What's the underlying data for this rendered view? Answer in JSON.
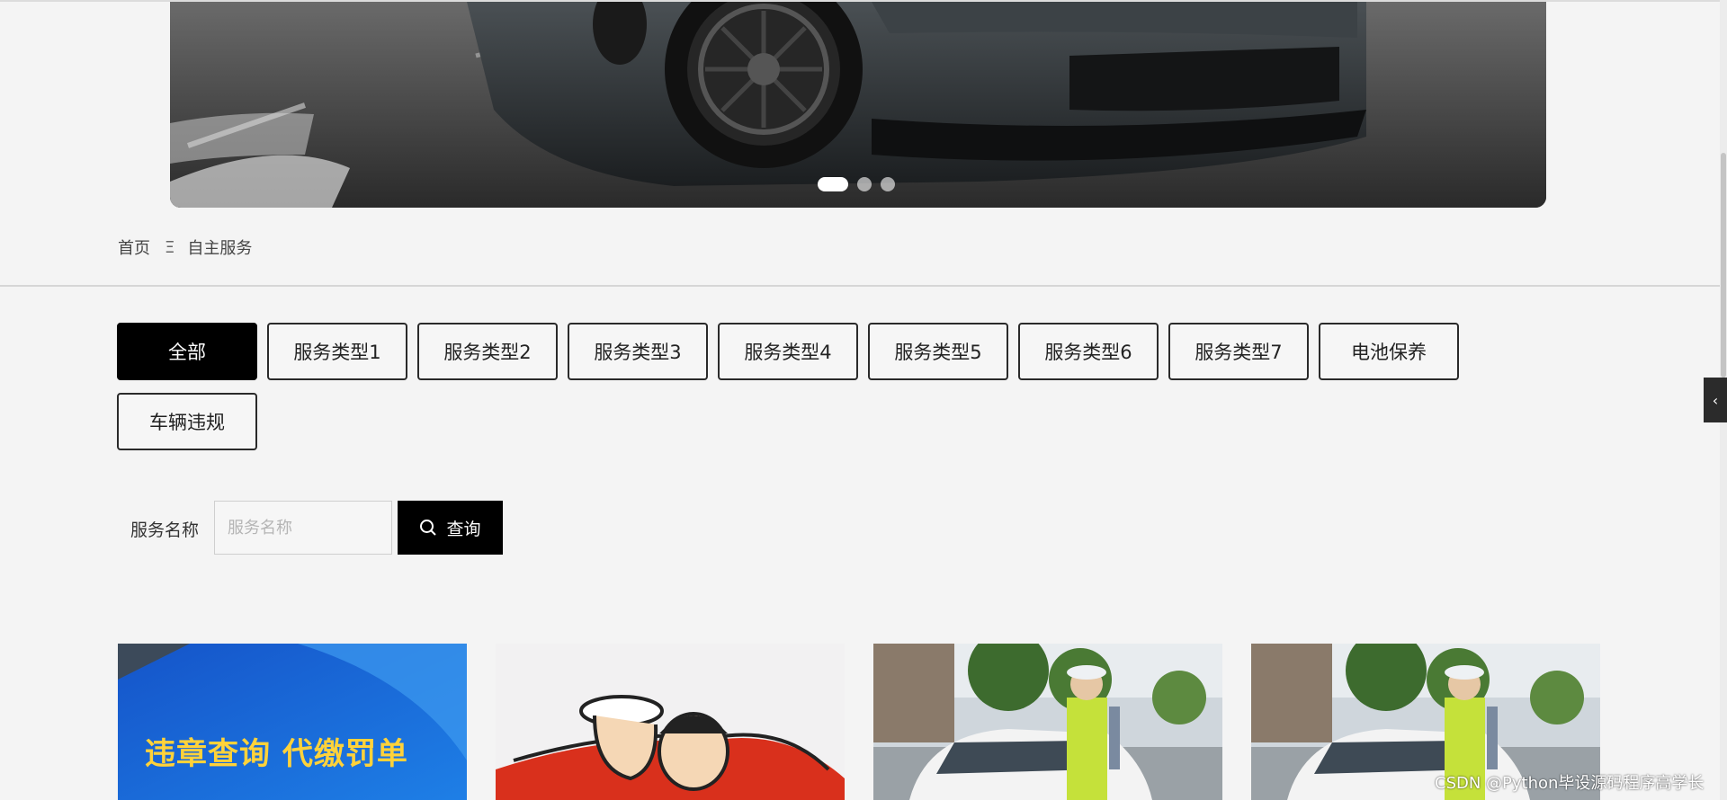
{
  "carousel": {
    "slide_count": 3,
    "active_index": 0
  },
  "breadcrumb": {
    "home": "首页",
    "separator": "Ξ",
    "current": "自主服务"
  },
  "categories": [
    {
      "label": "全部",
      "active": true
    },
    {
      "label": "服务类型1",
      "active": false
    },
    {
      "label": "服务类型2",
      "active": false
    },
    {
      "label": "服务类型3",
      "active": false
    },
    {
      "label": "服务类型4",
      "active": false
    },
    {
      "label": "服务类型5",
      "active": false
    },
    {
      "label": "服务类型6",
      "active": false
    },
    {
      "label": "服务类型7",
      "active": false
    },
    {
      "label": "电池保养",
      "active": false
    },
    {
      "label": "车辆违规",
      "active": false
    }
  ],
  "search": {
    "label": "服务名称",
    "value": "",
    "placeholder": "服务名称",
    "button_label": "查询"
  },
  "cards": [
    {
      "image_text": "违章查询 代缴罚单",
      "image": "violation-query-banner"
    },
    {
      "image": "police-cartoon"
    },
    {
      "image": "traffic-police-ticket-photo"
    },
    {
      "image": "traffic-police-ticket-photo"
    }
  ],
  "watermark": "CSDN @Python毕设源码程序高学长",
  "colors": {
    "accent": "#000000",
    "background": "#f4f4f4",
    "card_blue": "#1a73e8",
    "card_title": "#ffd23a"
  }
}
